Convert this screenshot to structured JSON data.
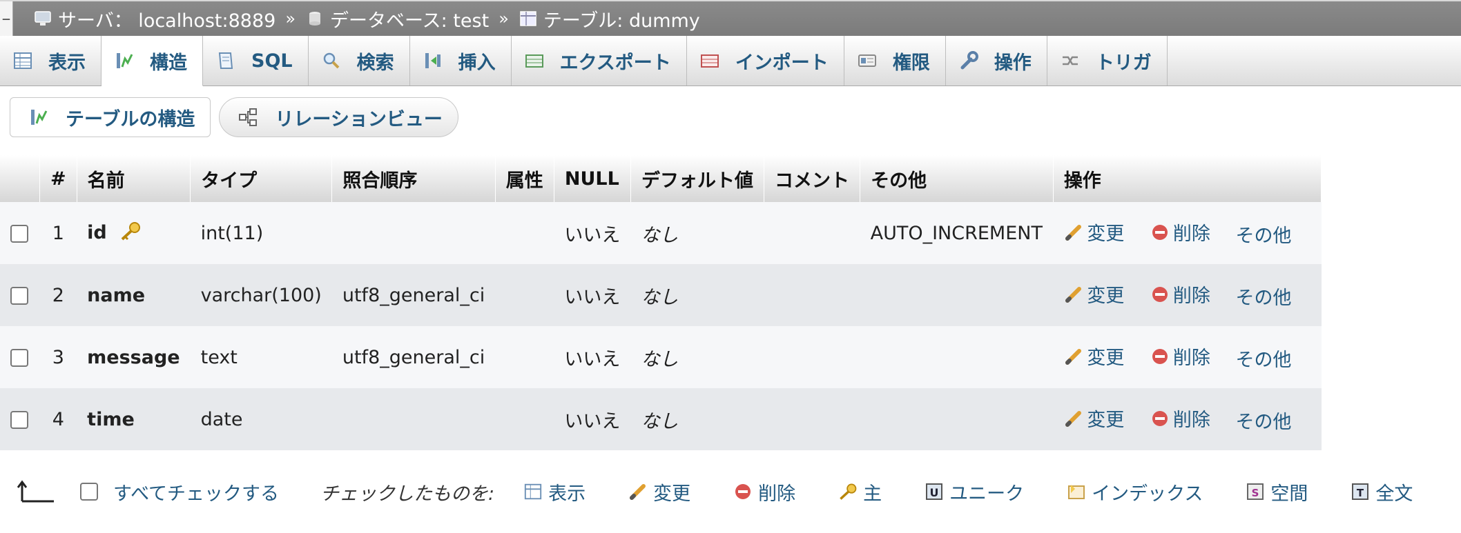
{
  "breadcrumb": {
    "server": "サーバ： localhost:8889",
    "database": "データベース: test",
    "table": "テーブル: dummy",
    "separator": "»"
  },
  "tabs": [
    {
      "label": "表示",
      "icon": "browse-icon"
    },
    {
      "label": "構造",
      "icon": "structure-icon",
      "active": true
    },
    {
      "label": "SQL",
      "icon": "sql-icon"
    },
    {
      "label": "検索",
      "icon": "search-icon"
    },
    {
      "label": "挿入",
      "icon": "insert-icon"
    },
    {
      "label": "エクスポート",
      "icon": "export-icon"
    },
    {
      "label": "インポート",
      "icon": "import-icon"
    },
    {
      "label": "権限",
      "icon": "privileges-icon"
    },
    {
      "label": "操作",
      "icon": "wrench-icon"
    },
    {
      "label": "トリガ",
      "icon": "triggers-icon"
    }
  ],
  "subtabs": {
    "structure": "テーブルの構造",
    "relation": "リレーションビュー"
  },
  "table": {
    "headers": {
      "num": "#",
      "name": "名前",
      "type": "タイプ",
      "collation": "照合順序",
      "attributes": "属性",
      "null": "NULL",
      "default": "デフォルト値",
      "comment": "コメント",
      "extra": "その他",
      "action": "操作"
    },
    "rows": [
      {
        "num": "1",
        "name": "id",
        "type": "int(11)",
        "collation": "",
        "attributes": "",
        "null": "いいえ",
        "default": "なし",
        "comment": "",
        "extra": "AUTO_INCREMENT",
        "primary": true
      },
      {
        "num": "2",
        "name": "name",
        "type": "varchar(100)",
        "collation": "utf8_general_ci",
        "attributes": "",
        "null": "いいえ",
        "default": "なし",
        "comment": "",
        "extra": ""
      },
      {
        "num": "3",
        "name": "message",
        "type": "text",
        "collation": "utf8_general_ci",
        "attributes": "",
        "null": "いいえ",
        "default": "なし",
        "comment": "",
        "extra": ""
      },
      {
        "num": "4",
        "name": "time",
        "type": "date",
        "collation": "",
        "attributes": "",
        "null": "いいえ",
        "default": "なし",
        "comment": "",
        "extra": ""
      }
    ],
    "row_actions": {
      "change": "変更",
      "drop": "削除",
      "more": "その他"
    }
  },
  "footer": {
    "check_all": "すべてチェックする",
    "with_selected": "チェックしたものを:",
    "actions": [
      {
        "label": "表示",
        "icon": "browse-icon"
      },
      {
        "label": "変更",
        "icon": "pencil-icon"
      },
      {
        "label": "削除",
        "icon": "drop-icon"
      },
      {
        "label": "主",
        "icon": "primary-key-icon"
      },
      {
        "label": "ユニーク",
        "icon": "unique-icon"
      },
      {
        "label": "インデックス",
        "icon": "index-icon"
      },
      {
        "label": "空間",
        "icon": "spatial-icon"
      },
      {
        "label": "全文",
        "icon": "fulltext-icon"
      }
    ]
  },
  "colors": {
    "link": "#235a81",
    "topbar": "#7b7b7b",
    "drop": "#d9534f"
  }
}
